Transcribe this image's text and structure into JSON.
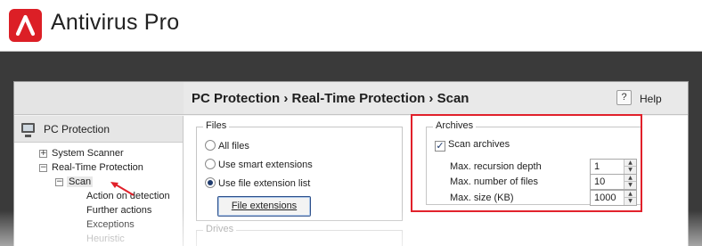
{
  "app": {
    "title": "Antivirus Pro",
    "brand_color": "#dc1f26",
    "logo_icon": "umbrella-logo-icon"
  },
  "header": {
    "breadcrumb": "PC Protection › Real-Time Protection › Scan",
    "help_icon_text": "?",
    "help_label": "Help"
  },
  "sidebar": {
    "title": "PC Protection",
    "title_icon": "computer-icon",
    "items": [
      {
        "label": "System Scanner",
        "expander": "+"
      },
      {
        "label": "Real-Time Protection",
        "expander": "−"
      },
      {
        "label": "Scan",
        "expander": "−",
        "selected": true
      },
      {
        "label": "Action on detection"
      },
      {
        "label": "Further actions"
      },
      {
        "label": "Exceptions"
      },
      {
        "label": "Heuristic"
      }
    ]
  },
  "files": {
    "title": "Files",
    "options": [
      "All files",
      "Use smart extensions",
      "Use file extension list"
    ],
    "selected_index": 2,
    "button_label": "File extensions"
  },
  "archives": {
    "title": "Archives",
    "scan_archives_label": "Scan archives",
    "scan_archives_checked": true,
    "fields": [
      {
        "label": "Max. recursion depth",
        "value": "1"
      },
      {
        "label": "Max. number of files",
        "value": "10"
      },
      {
        "label": "Max. size (KB)",
        "value": "1000"
      }
    ]
  },
  "drives": {
    "title": "Drives"
  },
  "annotation_color": "#e1202a"
}
